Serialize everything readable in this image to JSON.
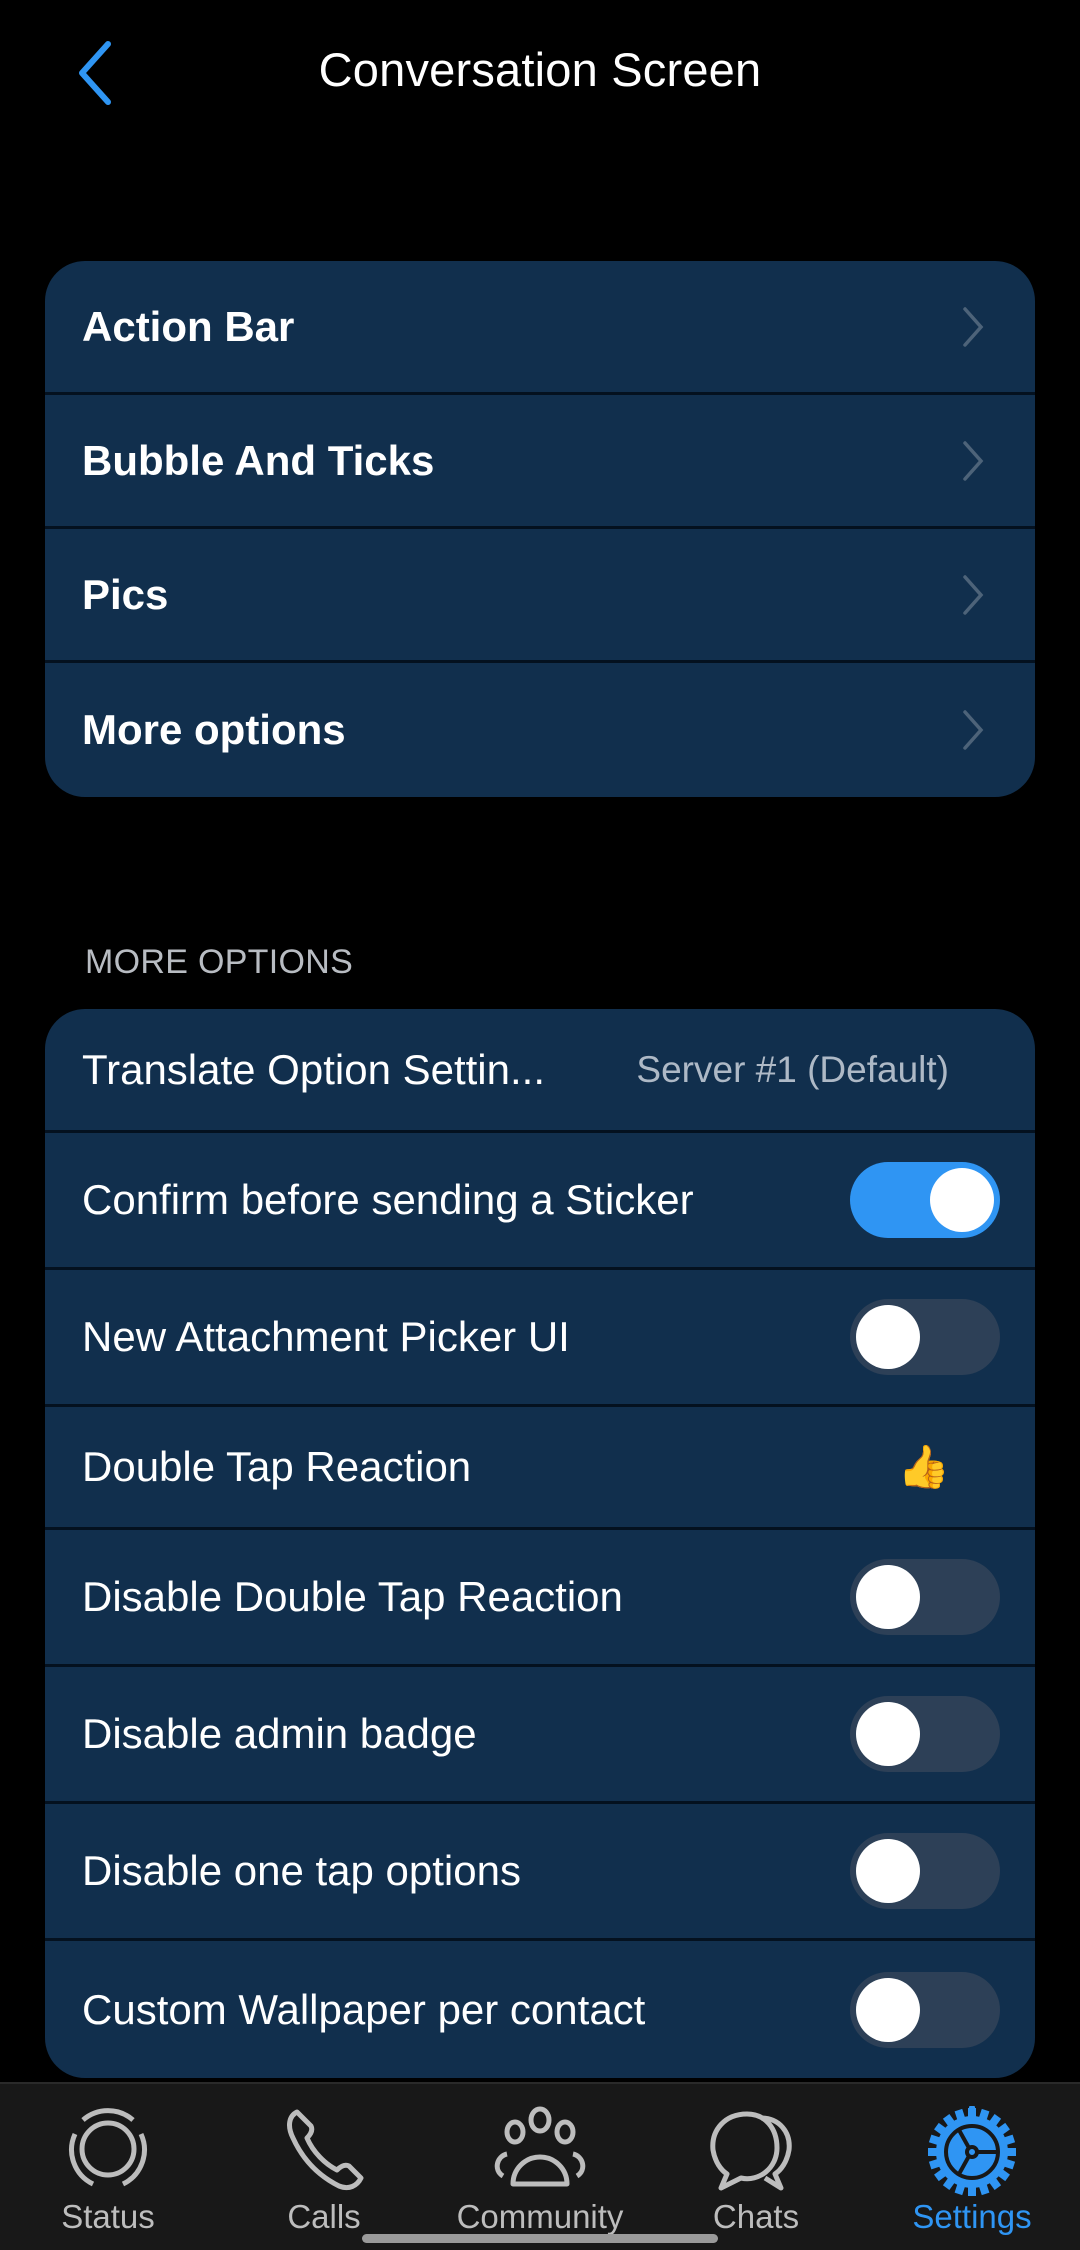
{
  "header": {
    "title": "Conversation Screen",
    "back_icon": "chevron-left-icon"
  },
  "nav_card": {
    "items": [
      {
        "label": "Action Bar"
      },
      {
        "label": "Bubble And Ticks"
      },
      {
        "label": "Pics"
      },
      {
        "label": "More options"
      }
    ]
  },
  "more_options": {
    "section_title": "MORE OPTIONS",
    "items": [
      {
        "label": "Translate Option Settin...",
        "value": "Server #1 (Default)"
      },
      {
        "label": "Confirm before sending a Sticker",
        "toggle": true
      },
      {
        "label": "New Attachment Picker UI",
        "toggle": false
      },
      {
        "label": "Double Tap Reaction",
        "value": "👍"
      },
      {
        "label": "Disable Double Tap Reaction",
        "toggle": false
      },
      {
        "label": "Disable admin badge",
        "toggle": false
      },
      {
        "label": "Disable one tap options",
        "toggle": false
      },
      {
        "label": "Custom Wallpaper per contact",
        "toggle": false
      }
    ]
  },
  "bottom_nav": {
    "active": "Settings",
    "tabs": [
      {
        "label": "Status",
        "icon": "status-icon"
      },
      {
        "label": "Calls",
        "icon": "phone-icon"
      },
      {
        "label": "Community",
        "icon": "community-icon"
      },
      {
        "label": "Chats",
        "icon": "chats-icon"
      },
      {
        "label": "Settings",
        "icon": "settings-gear-icon"
      }
    ]
  },
  "colors": {
    "accent": "#2f95f3",
    "card": "#112f4d",
    "background": "#000000",
    "nav_bg": "#181818"
  }
}
